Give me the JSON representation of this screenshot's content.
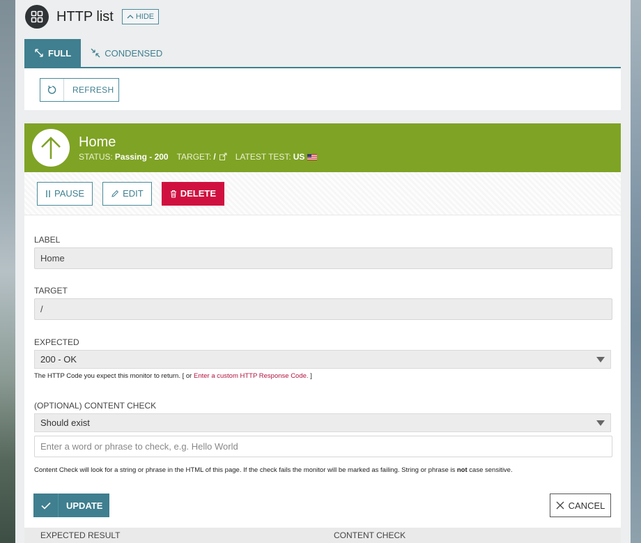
{
  "header": {
    "title": "HTTP list",
    "hide_label": "HIDE"
  },
  "tabs": [
    {
      "label": "FULL",
      "active": true
    },
    {
      "label": "CONDENSED",
      "active": false
    }
  ],
  "toolbar": {
    "refresh_label": "REFRESH"
  },
  "monitor": {
    "name": "Home",
    "status_key": "STATUS:",
    "status_value": "Passing - 200",
    "target_key": "TARGET:",
    "target_value": "/",
    "latest_key": "LATEST TEST:",
    "latest_value": "US",
    "status_color": "#7fa325"
  },
  "actions": {
    "pause": "PAUSE",
    "edit": "EDIT",
    "delete": "DELETE"
  },
  "form": {
    "label_title": "LABEL",
    "label_value": "Home",
    "target_title": "TARGET",
    "target_value": "/",
    "expected_title": "EXPECTED",
    "expected_value": "200 - OK",
    "expected_hint_prefix": "The HTTP Code you expect this monitor to return. [ or ",
    "expected_hint_link": "Enter a custom HTTP Response Code.",
    "expected_hint_suffix": " ]",
    "content_title": "(OPTIONAL) CONTENT CHECK",
    "content_mode": "Should exist",
    "content_placeholder": "Enter a word or phrase to check, e.g. Hello World",
    "content_hint_a": "Content Check will look for a string or phrase in the HTML of this page. If the check fails the monitor will be marked as failing. String or phrase is ",
    "content_hint_bold": "not",
    "content_hint_b": " case sensitive."
  },
  "buttons": {
    "update": "UPDATE",
    "cancel": "CANCEL"
  },
  "results": {
    "col1": "EXPECTED RESULT",
    "col2": "CONTENT CHECK"
  },
  "colors": {
    "accent": "#3f7f8f",
    "danger": "#d0113f",
    "passing": "#7fa325"
  }
}
